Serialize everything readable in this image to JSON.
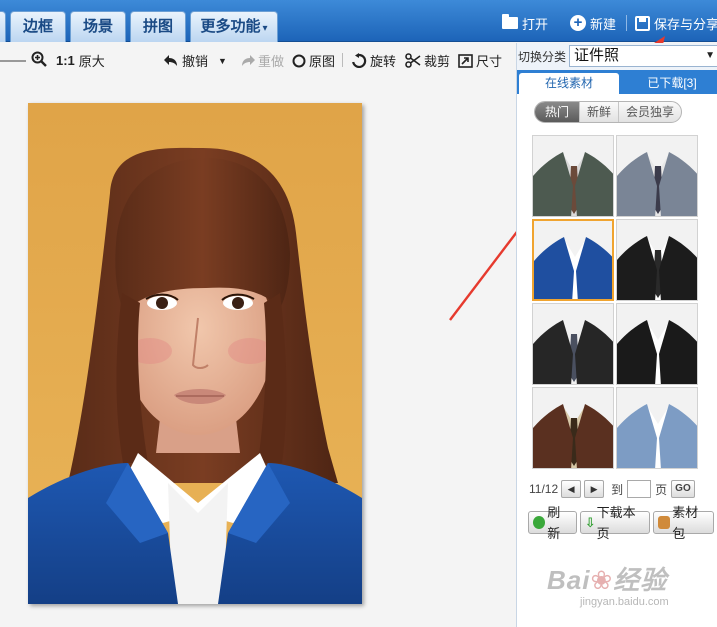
{
  "topbar": {
    "tabs": [
      {
        "label": "边框"
      },
      {
        "label": "场景"
      },
      {
        "label": "拼图"
      },
      {
        "label": "更多功能"
      }
    ],
    "open_label": "打开",
    "new_label": "新建",
    "save_share_label": "保存与分享"
  },
  "toolbar": {
    "ratio_label": "1:1",
    "original_size_label": "原大",
    "undo_label": "撤销",
    "redo_label": "重做",
    "original_label": "原图",
    "rotate_label": "旋转",
    "crop_label": "裁剪",
    "size_label": "尺寸"
  },
  "panel": {
    "category_label": "切换分类",
    "category_value": "证件照",
    "tabs": {
      "online": "在线素材",
      "downloaded": "已下载[3]"
    },
    "filters": {
      "hot": "热门",
      "new": "新鲜",
      "vip": "会员独享"
    },
    "thumbnails": [
      {
        "name": "grey-green-suit",
        "jacket": "#4d5a50",
        "shirt": "#d9d9d9",
        "tie": "#6b4a3a"
      },
      {
        "name": "grey-blue-suit",
        "jacket": "#7a8596",
        "shirt": "#e8e8e8",
        "tie": "#3b3b4b"
      },
      {
        "name": "blue-blazer-white-collar",
        "jacket": "#1f4fa0",
        "shirt": "#ffffff",
        "tie": ""
      },
      {
        "name": "black-suit-tie",
        "jacket": "#1c1c1c",
        "shirt": "#ffffff",
        "tie": "#2a2a2a"
      },
      {
        "name": "black-suit-striped-tie",
        "jacket": "#262626",
        "shirt": "#f0f0f0",
        "tie": "#4a5060"
      },
      {
        "name": "black-jacket-white-collar",
        "jacket": "#1a1a1a",
        "shirt": "#ffffff",
        "tie": ""
      },
      {
        "name": "brown-suit",
        "jacket": "#5a3020",
        "shirt": "#d8c9a8",
        "tie": "#3a2a1a"
      },
      {
        "name": "light-blue-jacket",
        "jacket": "#7d9cc4",
        "shirt": "#ffffff",
        "tie": ""
      }
    ],
    "pager": {
      "page_info": "11/12",
      "goto_label": "到",
      "page_unit": "页",
      "go_label": "GO",
      "page_value": ""
    },
    "actions": {
      "refresh": "刷新",
      "download_page": "下载本页",
      "material_pack": "素材包"
    }
  },
  "watermark": {
    "brand": "Bai 经验",
    "url": "jingyan.baidu.com"
  },
  "colors": {
    "topbar": "#1d64b8",
    "accent_red": "#e63a2e",
    "selected_border": "#f0a430"
  }
}
